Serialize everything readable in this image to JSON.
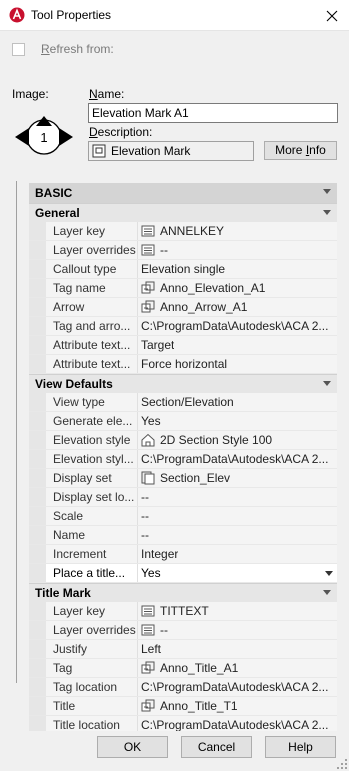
{
  "window": {
    "title": "Tool Properties"
  },
  "refresh": {
    "label": "Refresh from:",
    "checked": false
  },
  "image": {
    "label": "Image:",
    "bubble_text": "1"
  },
  "name": {
    "label": "Name:",
    "value": "Elevation Mark A1"
  },
  "description": {
    "label": "Description:",
    "value": "Elevation Mark"
  },
  "buttons": {
    "more_info": "More Info",
    "ok": "OK",
    "cancel": "Cancel",
    "help": "Help"
  },
  "basic": {
    "label": "BASIC"
  },
  "sections": [
    {
      "title": "General",
      "rows": [
        {
          "name": "Layer key",
          "value": "ANNELKEY",
          "icon": "list-icon"
        },
        {
          "name": "Layer overrides",
          "value": "--",
          "icon": "list-icon"
        },
        {
          "name": "Callout type",
          "value": "Elevation single"
        },
        {
          "name": "Tag name",
          "value": "Anno_Elevation_A1",
          "icon": "block-icon"
        },
        {
          "name": "Arrow",
          "value": "Anno_Arrow_A1",
          "icon": "block-icon"
        },
        {
          "name": "Tag and arro...",
          "value": "C:\\ProgramData\\Autodesk\\ACA  2..."
        },
        {
          "name": "Attribute text...",
          "value": "Target"
        },
        {
          "name": "Attribute text...",
          "value": "Force horizontal"
        }
      ]
    },
    {
      "title": "View Defaults",
      "rows": [
        {
          "name": "View type",
          "value": "Section/Elevation"
        },
        {
          "name": "Generate  ele...",
          "value": "Yes"
        },
        {
          "name": "Elevation style",
          "value": "2D Section Style 100",
          "icon": "house-icon"
        },
        {
          "name": "Elevation styl...",
          "value": "C:\\ProgramData\\Autodesk\\ACA  2..."
        },
        {
          "name": "Display set",
          "value": "Section_Elev",
          "icon": "display-set-icon"
        },
        {
          "name": "Display set lo...",
          "value": "--"
        },
        {
          "name": "Scale",
          "value": "--"
        },
        {
          "name": "Name",
          "value": "--"
        },
        {
          "name": "Increment",
          "value": "Integer"
        },
        {
          "name": "Place a title...",
          "value": "Yes",
          "editable": true,
          "dropdown": true
        }
      ]
    },
    {
      "title": "Title Mark",
      "rows": [
        {
          "name": "Layer key",
          "value": "TITTEXT",
          "icon": "list-icon"
        },
        {
          "name": "Layer overrides",
          "value": "--",
          "icon": "list-icon"
        },
        {
          "name": "Justify",
          "value": "Left"
        },
        {
          "name": "Tag",
          "value": "Anno_Title_A1",
          "icon": "block-icon"
        },
        {
          "name": "Tag location",
          "value": "C:\\ProgramData\\Autodesk\\ACA  2..."
        },
        {
          "name": "Title",
          "value": "Anno_Title_T1",
          "icon": "block-icon"
        },
        {
          "name": "Title location",
          "value": "C:\\ProgramData\\Autodesk\\ACA  2..."
        }
      ]
    }
  ],
  "colors": {
    "app_icon": "#c8102e",
    "section_header": "#e6e6e6",
    "basic_header": "#d4d4d4"
  }
}
